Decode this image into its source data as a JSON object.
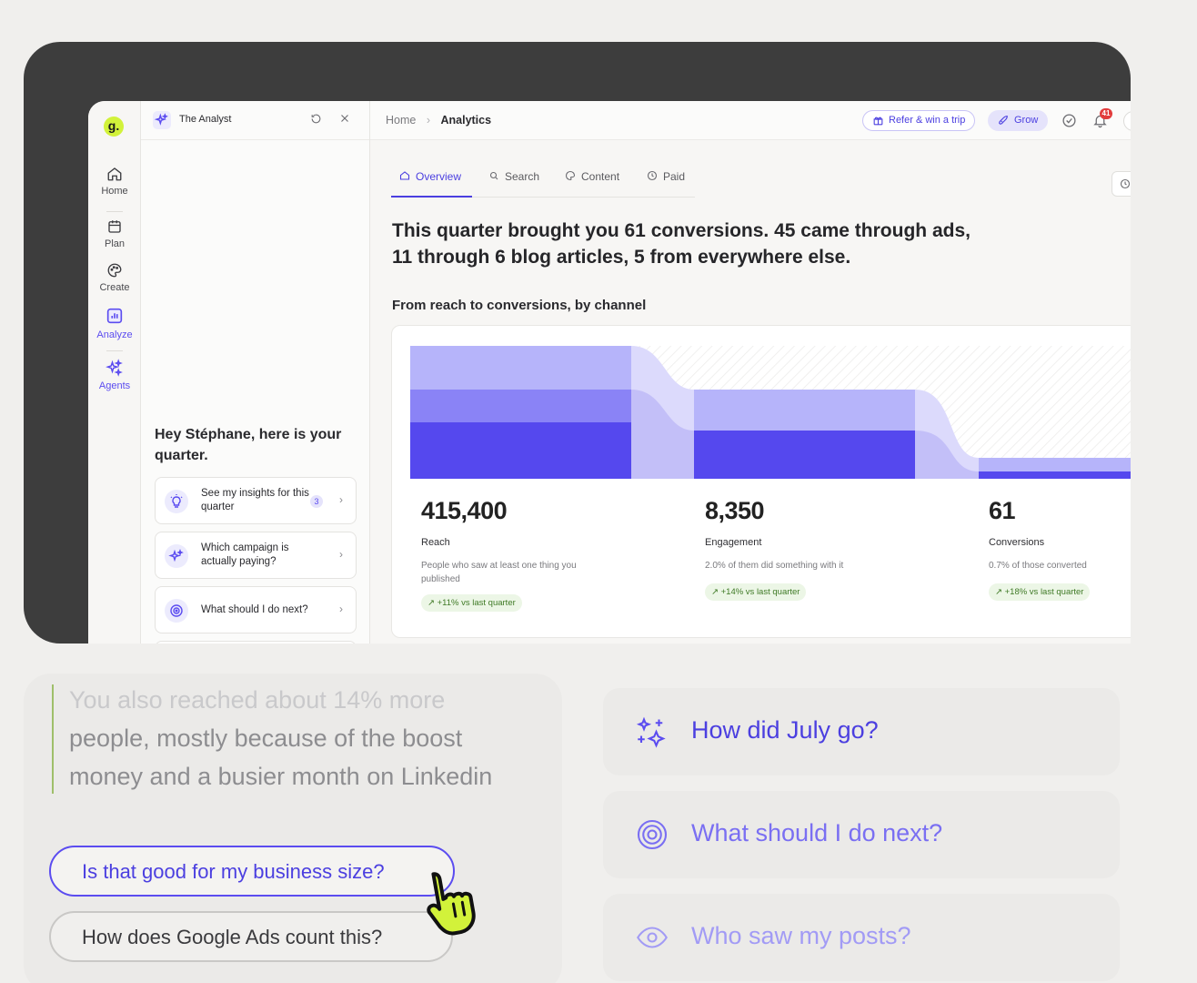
{
  "colors": {
    "accent": "#4b3fe0",
    "brand_lime": "#d2f23a",
    "delta_green": "#3f7a26"
  },
  "rail": {
    "logo": "g.",
    "items": [
      {
        "label": "Home",
        "icon": "home-icon"
      },
      {
        "label": "Plan",
        "icon": "calendar-icon"
      },
      {
        "label": "Create",
        "icon": "palette-icon"
      },
      {
        "label": "Analyze",
        "icon": "chart-icon"
      },
      {
        "label": "Agents",
        "icon": "sparkles-icon"
      }
    ]
  },
  "panel": {
    "title": "The Analyst",
    "greeting": "Hey Stéphane, here is your quarter.",
    "cards": [
      {
        "text": "See my insights for this quarter",
        "badge": "3",
        "icon": "lightbulb-icon"
      },
      {
        "text": "Which campaign is actually paying?",
        "icon": "sparkles-icon"
      },
      {
        "text": "What should I do next?",
        "icon": "target-icon"
      }
    ]
  },
  "topbar": {
    "breadcrumb_home": "Home",
    "breadcrumb_current": "Analytics",
    "refer": "Refer & win a trip",
    "grow": "Grow",
    "notifications": "41"
  },
  "tabs": [
    "Overview",
    "Search",
    "Content",
    "Paid"
  ],
  "headline": "This quarter brought you 61 conversions. 45 came through ads, 11 through 6 blog articles, 5 from everywhere else.",
  "subhead": "From reach to conversions, by channel",
  "metrics": [
    {
      "value": "415,400",
      "label": "Reach",
      "desc": "People who saw at least one thing you published",
      "delta": "+11% vs last quarter"
    },
    {
      "value": "8,350",
      "label": "Engagement",
      "desc": "2.0% of them did something with it",
      "delta": "+14% vs last quarter"
    },
    {
      "value": "61",
      "label": "Conversions",
      "desc": "0.7% of those converted",
      "delta": "+18% vs last quarter"
    }
  ],
  "lower": {
    "quote_line1": "You also reached about 14% more",
    "quote_line2": "people, mostly because of the boost",
    "quote_line3": "money and a busier month on Linkedin",
    "followup_primary": "Is that good for my business size?",
    "followup_secondary": "How does Google Ads count this?",
    "suggestions": [
      {
        "text": "How did July go?",
        "icon": "sparkles-icon"
      },
      {
        "text": "What should I do next?",
        "icon": "target-icon"
      },
      {
        "text": "Who saw my posts?",
        "icon": "eye-icon"
      }
    ]
  }
}
